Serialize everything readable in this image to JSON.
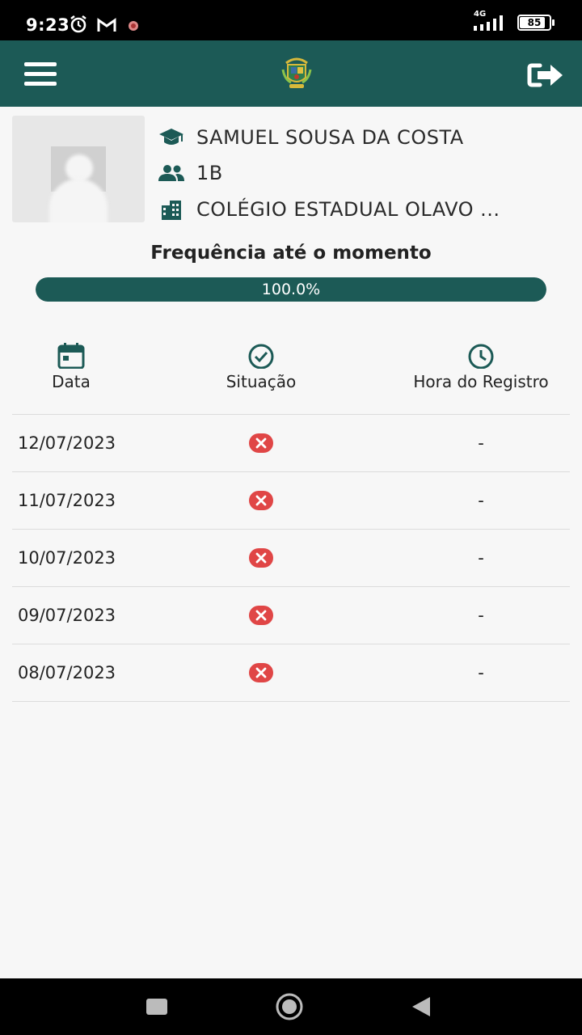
{
  "status_bar": {
    "time": "9:23",
    "network": "4G",
    "battery": "85"
  },
  "app_bar": {
    "menu_icon": "hamburger-menu-icon",
    "logo": "state-coat-of-arms-logo",
    "logout_icon": "logout-icon"
  },
  "student": {
    "name": "SAMUEL SOUSA DA COSTA",
    "class": "1B",
    "school": "COLÉGIO ESTADUAL OLAVO ..."
  },
  "attendance": {
    "title": "Frequência até o momento",
    "percent_label": "100.0%",
    "progress_fraction": 1.0
  },
  "columns": {
    "date": "Data",
    "status": "Situação",
    "time": "Hora do Registro"
  },
  "records": [
    {
      "date": "12/07/2023",
      "status": "absent",
      "time": "-"
    },
    {
      "date": "11/07/2023",
      "status": "absent",
      "time": "-"
    },
    {
      "date": "10/07/2023",
      "status": "absent",
      "time": "-"
    },
    {
      "date": "09/07/2023",
      "status": "absent",
      "time": "-"
    },
    {
      "date": "08/07/2023",
      "status": "absent",
      "time": "-"
    }
  ],
  "colors": {
    "primary": "#1c5a56",
    "absent": "#e04646",
    "background": "#f7f7f7"
  }
}
